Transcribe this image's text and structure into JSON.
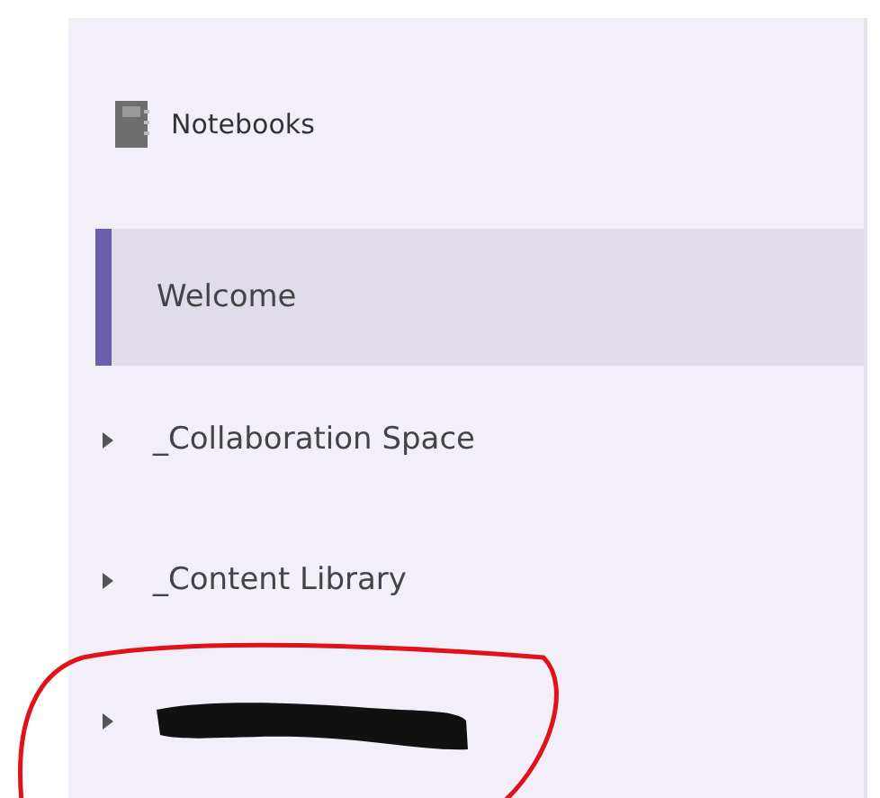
{
  "sidebar": {
    "header": {
      "label": "Notebooks"
    },
    "items": [
      {
        "label": "Welcome",
        "selected": true,
        "expandable": false,
        "redacted": false,
        "circled": false
      },
      {
        "label": "_Collaboration Space",
        "selected": false,
        "expandable": true,
        "redacted": false,
        "circled": false
      },
      {
        "label": "_Content Library",
        "selected": false,
        "expandable": true,
        "redacted": false,
        "circled": false
      },
      {
        "selected": false,
        "expandable": true,
        "redacted": true,
        "circled": true
      }
    ]
  }
}
